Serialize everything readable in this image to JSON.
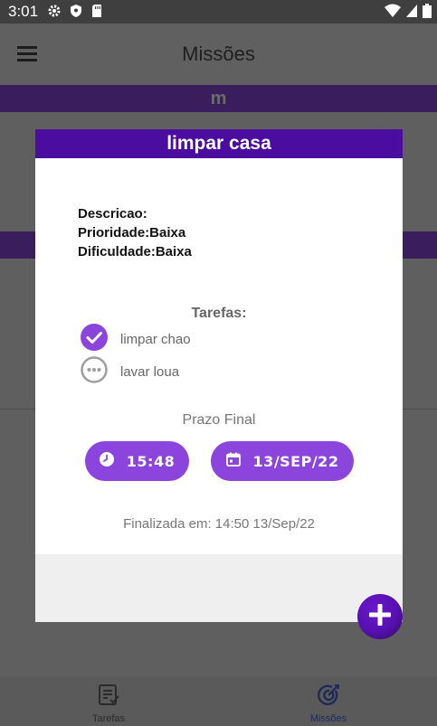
{
  "status_bar": {
    "time": "3:01"
  },
  "app_bar": {
    "title": "Missões"
  },
  "background": {
    "card_title": "m"
  },
  "dialog": {
    "title": "limpar casa",
    "description_label": "Descricao:",
    "priority_label": "Prioridade:Baixa",
    "difficulty_label": "Dificuldade:Baixa",
    "tasks_title": "Tarefas:",
    "tasks": [
      {
        "label": "limpar chao",
        "status": "done"
      },
      {
        "label": "lavar loua",
        "status": "pending"
      }
    ],
    "deadline_title": "Prazo Final",
    "deadline_time": "15:48",
    "deadline_date": "13/SEP/22",
    "finished_text": "Finalizada em: 14:50 13/Sep/22"
  },
  "bottom_nav": {
    "items": [
      {
        "label": "Tarefas",
        "icon": "task-list-icon"
      },
      {
        "label": "Missões",
        "icon": "target-icon",
        "active": true
      }
    ]
  },
  "colors": {
    "accent": "#8b45dc",
    "header": "#4a0da0",
    "fab": "#5d11b8"
  }
}
